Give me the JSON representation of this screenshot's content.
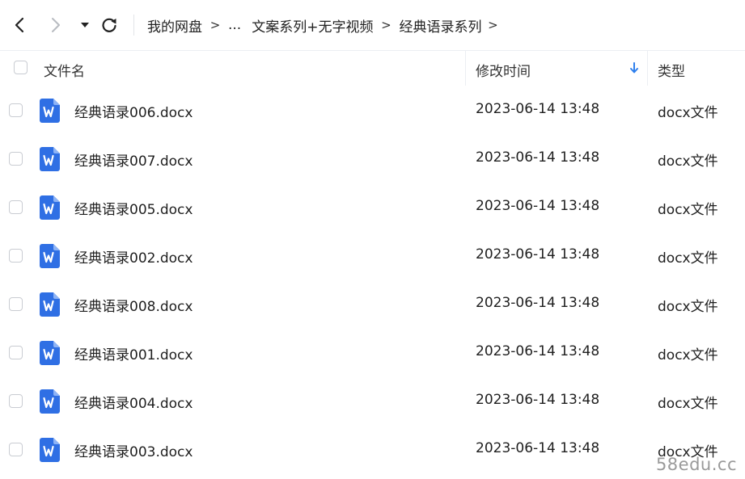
{
  "toolbar": {
    "back_icon": "chevron-left-icon",
    "forward_icon": "chevron-right-icon",
    "history_icon": "caret-down-icon",
    "refresh_icon": "refresh-icon"
  },
  "breadcrumb": {
    "root": "我的网盘",
    "ellipsis": "...",
    "parent": "文案系列+无字视频",
    "current": "经典语录系列",
    "separator": ">"
  },
  "columns": {
    "name": "文件名",
    "modified": "修改时间",
    "type": "类型",
    "sort_icon": "arrow-down-icon"
  },
  "files": [
    {
      "name": "经典语录006.docx",
      "modified": "2023-06-14 13:48",
      "type": "docx文件"
    },
    {
      "name": "经典语录007.docx",
      "modified": "2023-06-14 13:48",
      "type": "docx文件"
    },
    {
      "name": "经典语录005.docx",
      "modified": "2023-06-14 13:48",
      "type": "docx文件"
    },
    {
      "name": "经典语录002.docx",
      "modified": "2023-06-14 13:48",
      "type": "docx文件"
    },
    {
      "name": "经典语录008.docx",
      "modified": "2023-06-14 13:48",
      "type": "docx文件"
    },
    {
      "name": "经典语录001.docx",
      "modified": "2023-06-14 13:48",
      "type": "docx文件"
    },
    {
      "name": "经典语录004.docx",
      "modified": "2023-06-14 13:48",
      "type": "docx文件"
    },
    {
      "name": "经典语录003.docx",
      "modified": "2023-06-14 13:48",
      "type": "docx文件"
    }
  ],
  "file_icon": "word-document-icon",
  "watermark": "58edu.cc",
  "colors": {
    "word_blue": "#2f6fe4",
    "sort_arrow": "#2f80ed"
  }
}
